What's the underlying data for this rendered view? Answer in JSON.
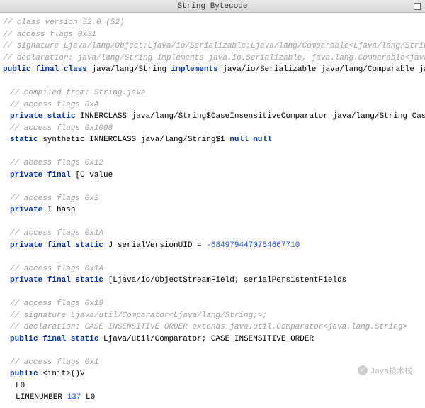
{
  "window": {
    "title": "String Bytecode"
  },
  "code": {
    "c0": "// class version 52.0 (52)",
    "c1": "// access flags 0x31",
    "c2": "// signature Ljava/lang/Object;Ljava/io/Serializable;Ljava/lang/Comparable<Ljava/lang/String;>;Ljav",
    "c3": "// declaration: java/lang/String implements java.io.Serializable, java.lang.Comparable<java.lang.St",
    "l4_kw": "public final class",
    "l4_name": " java/lang/String ",
    "l4_kw2": "implements",
    "l4_rest": " java/io/Serializable java/lang/Comparable java/lang/",
    "c5": "// compiled from: String.java",
    "c6": "// access flags 0xA",
    "l7_kw": "private static",
    "l7_rest": " INNERCLASS java/lang/String$CaseInsensitiveComparator java/lang/String CaseInsensi",
    "c8": "// access flags 0x1008",
    "l9_kw": "static",
    "l9_mid": " synthetic INNERCLASS java/lang/String$1 ",
    "l9_kw2": "null null",
    "c10": "// access flags 0x12",
    "l11_kw": "private final",
    "l11_rest": " [C value",
    "c12": "// access flags 0x2",
    "l13_kw": "private",
    "l13_rest": " I hash",
    "c14": "// access flags 0x1A",
    "l15_kw": "private final static",
    "l15_mid": " J serialVersionUID = ",
    "l15_num": "-6849794470754667710",
    "c16": "// access flags 0x1A",
    "l17_kw": "private final static",
    "l17_rest": " [Ljava/io/ObjectStreamField; serialPersistentFields",
    "c18": "// access flags 0x19",
    "c19": "// signature Ljava/util/Comparator<Ljava/lang/String;>;",
    "c20": "// declaration: CASE_INSENSITIVE_ORDER extends java.util.Comparator<java.lang.String>",
    "l21_kw": "public final static",
    "l21_rest": " Ljava/util/Comparator; CASE_INSENSITIVE_ORDER",
    "c22": "// access flags 0x1",
    "l23_kw": "public",
    "l23_rest": " <init>()V",
    "l24": "L0",
    "l25_a": "LINENUMBER ",
    "l25_num": "137",
    "l25_b": " L0"
  },
  "watermark": {
    "text": "Java技术栈"
  }
}
